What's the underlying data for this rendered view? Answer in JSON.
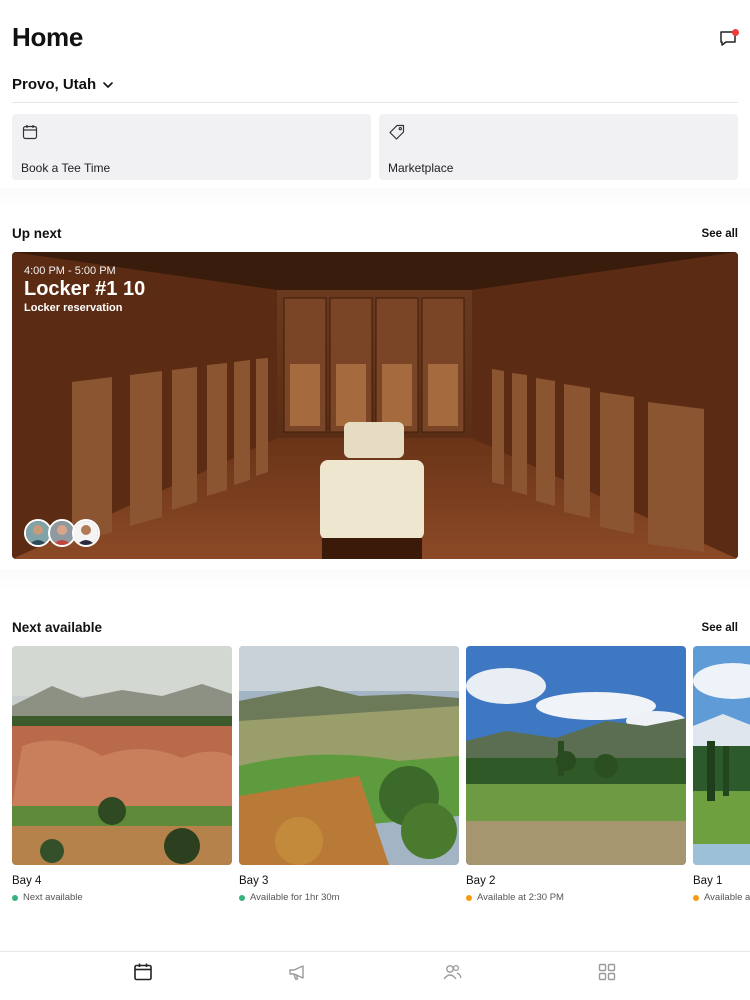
{
  "header": {
    "title": "Home"
  },
  "location": {
    "label": "Provo, Utah"
  },
  "quick_actions": [
    {
      "label": "Book a Tee Time",
      "icon": "calendar-icon"
    },
    {
      "label": "Marketplace",
      "icon": "tag-icon"
    }
  ],
  "up_next": {
    "title": "Up next",
    "see_all": "See all",
    "reservation": {
      "time": "4:00 PM - 5:00 PM",
      "name": "Locker #1 10",
      "type": "Locker reservation"
    }
  },
  "next_available": {
    "title": "Next available",
    "see_all": "See all",
    "bays": [
      {
        "name": "Bay 4",
        "status": "Next available",
        "status_color": "#36b37e"
      },
      {
        "name": "Bay 3",
        "status": "Available for 1hr 30m",
        "status_color": "#36b37e"
      },
      {
        "name": "Bay 2",
        "status": "Available at 2:30 PM",
        "status_color": "#f39c12"
      },
      {
        "name": "Bay 1",
        "status": "Available at",
        "status_color": "#f39c12"
      }
    ]
  },
  "tabbar": [
    "calendar-icon",
    "megaphone-icon",
    "people-icon",
    "grid-icon"
  ],
  "colors": {
    "accent": "#111111",
    "notification": "#ef3b3b",
    "card_bg": "#f1f1f3"
  }
}
